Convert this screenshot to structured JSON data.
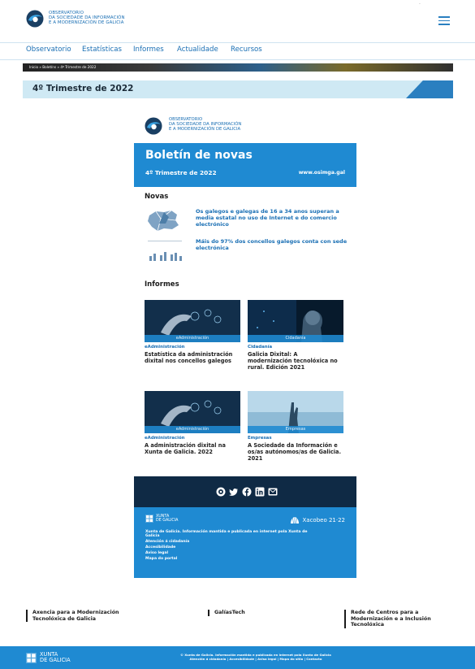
{
  "header": {
    "logo_lines": [
      "OBSERVATORIO",
      "DA SOCIEDADE DA INFORMACIÓN",
      "E A MODERNIZACIÓN DE GALICIA"
    ]
  },
  "nav": [
    "Observatorio",
    "Estatísticas",
    "Informes",
    "Actualidade",
    "Recursos"
  ],
  "breadcrumb": "Inicio » Boletíns » 4º Trimestre de 2022",
  "page_title": "4º Trimestre de 2022",
  "newsletter": {
    "logo_lines": [
      "OBSERVATORIO",
      "DA SOCIEDADE DA INFORMACIÓN",
      "E A MODERNIZACIÓN DE GALICIA"
    ],
    "title": "Boletín de novas",
    "subtitle": "4º Trimestre de 2022",
    "url": "www.osimga.gal",
    "news_heading": "Novas",
    "news": [
      "Os galegos e galegas de 16 a 34 anos superan a media estatal no uso de Internet e do comercio electrónico",
      "Máis do 97% dos concellos galegos conta con sede electrónica"
    ],
    "reports_heading": "Informes",
    "reports": [
      {
        "tag": "eAdministración",
        "category": "eAdministración",
        "title": "Estatística da administración dixital nos concellos galegos"
      },
      {
        "tag": "Cidadanía",
        "category": "Cidadanía",
        "title": "Galicia Dixital: A modernización tecnolóxica no rural. Edición 2021"
      },
      {
        "tag": "eAdministración",
        "category": "eAdministración",
        "title": "A administración dixital na Xunta de Galicia. 2022"
      },
      {
        "tag": "Empresas",
        "category": "Empresas",
        "title": "A Sociedade da Información e os/as autónomos/as de Galicia. 2021"
      }
    ],
    "social_icons": [
      "slideshare-icon",
      "twitter-icon",
      "facebook-icon",
      "linkedin-icon",
      "email-icon"
    ],
    "footer": {
      "xunta": [
        "XUNTA",
        "DE GALICIA"
      ],
      "xacobeo": "Xacobeo 21·22",
      "lines": [
        "Xunta de Galicia. Información mantida e publicada en internet pola Xunta de Galicia",
        "Atención á cidadanía",
        "Accesibilidade",
        "Aviso legal",
        "Mapa do portal"
      ]
    }
  },
  "bottom_links": [
    "Axencia para a Modernización Tecnolóxica de Galicia",
    "GalíasTech",
    "Rede de Centros para a Modernización e a Inclusión Tecnolóxica"
  ],
  "page_footer": {
    "xunta": [
      "XUNTA",
      "DE GALICIA"
    ],
    "line1": "© Xunta de Galicia. Información mantida e publicada en internet pola Xunta de Galicia",
    "line2": "Atención á cidadanía | Accesibilidade | Aviso legal | Mapa do sitio | Contacto"
  },
  "colors": {
    "brand_blue": "#1f8ad2",
    "link_blue": "#1a6fb4",
    "navy": "#0f2a45",
    "title_bar": "#cfe9f4"
  }
}
